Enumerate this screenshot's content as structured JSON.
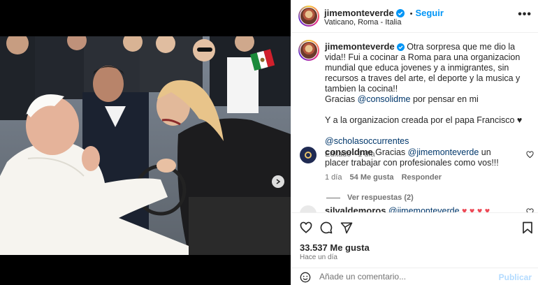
{
  "post": {
    "username": "jimemonteverde",
    "follow_label": "Seguir",
    "location": "Vaticano, Roma - Italia",
    "more_label": "•••"
  },
  "caption": {
    "text_1": "Otra sorpresa que me dio la vida!! Fui a cocinar a Roma para una organizacion mundial que educa jovenes y a inmigrantes, sin recursos a traves del arte, el deporte y la musica y tambien la cocina!!",
    "gracias": "Gracias",
    "mention_1": "@consolidme",
    "gracias_tail": "por pensar en mi",
    "text_2": "Y a la organizacion creada por el papa Francisco ♥",
    "mention_2": "@scholasoccurrentes",
    "edited": "Editado",
    "time": "1 día"
  },
  "comments": [
    {
      "username": "consoldme",
      "pre": "Gracias",
      "mention": "@jimemonteverde",
      "text": "un placer trabajar con profesionales como vos!!!",
      "time": "1 día",
      "likes": "54 Me gusta",
      "reply": "Responder",
      "view_replies": "Ver respuestas (2)"
    },
    {
      "username": "silvaldemoros",
      "mention": "@jimemonteverde",
      "text": "♥ ♥ ♥ ♥"
    }
  ],
  "footer": {
    "likes": "33.537 Me gusta",
    "ago": "Hace un día",
    "comment_placeholder": "Añade un comentario...",
    "publish_label": "Publicar"
  },
  "colors": {
    "accent": "#0095f6",
    "mention": "#00376b",
    "heart_red": "#ed4956",
    "publish_disabled": "#b3dbff"
  },
  "icons": [
    "heart-icon",
    "comment-icon",
    "share-icon",
    "bookmark-icon",
    "emoji-icon",
    "verified-icon",
    "more-icon",
    "next-arrow-icon",
    "user-tag-icon"
  ]
}
